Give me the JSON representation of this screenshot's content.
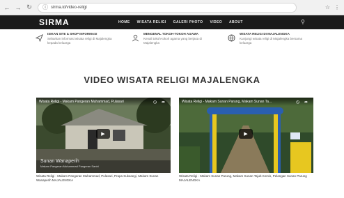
{
  "browser": {
    "url": "sirma.id/video-religi",
    "back_icon": "back-arrow-icon",
    "forward_icon": "forward-arrow-icon",
    "reload_icon": "reload-icon",
    "info_icon": "info-icon",
    "bookmark_icon": "star-icon",
    "menu_icon": "more-vert-icon"
  },
  "site": {
    "logo": "SIRMA",
    "nav": [
      "HOME",
      "WISATA RELIGI",
      "GALERI PHOTO",
      "VIDEO",
      "ABOUT"
    ],
    "search_icon": "search-icon"
  },
  "features": [
    {
      "icon": "send-icon",
      "title": "ISIKAN SITE & SHOP INFORMASI",
      "desc": "Sebarkan informasi wisata religi di Majalengka kepada keluarga"
    },
    {
      "icon": "user-icon",
      "title": "MENGENAL TOKOH-TOKOH AGAMA",
      "desc": "Kenali tokoh-tokoh agama yang berjasa di Majalengka"
    },
    {
      "icon": "globe-icon",
      "title": "WISATA RELIGI DI MAJALENGKA",
      "desc": "Kunjungi wisata religi di Majalengka bersama keluarga"
    }
  ],
  "section": {
    "title": "VIDEO WISATA RELIGI MAJALENGKA"
  },
  "videos": [
    {
      "title": "Wisata Religi - Makam Pangeran Muhammad, Pulasari",
      "overlay_big": "Sunan Wanaperih",
      "overlay_small": "Makam Pangeran Muhammad Pangeran Santri",
      "caption": "Wisata Religi - Makam Pangeran Muhammad, Pulasari, Prapa Sukasegi, Makam Sunan Wanaperih MAJALENGKA"
    },
    {
      "title": "Wisata Religi - Makam Sunan Parung, Makam Sunan Ta...",
      "overlay_big": "",
      "overlay_small": "",
      "caption": "Wisata Religi - Makam Sunan Parung, Makam Sunan Tajub Kemis, Pelangan Sunan Parung MAJALENGKA"
    }
  ],
  "colors": {
    "header_bg": "#1b1b1b",
    "accent_yellow": "#e7c720",
    "accent_blue": "#2a5fb0"
  }
}
